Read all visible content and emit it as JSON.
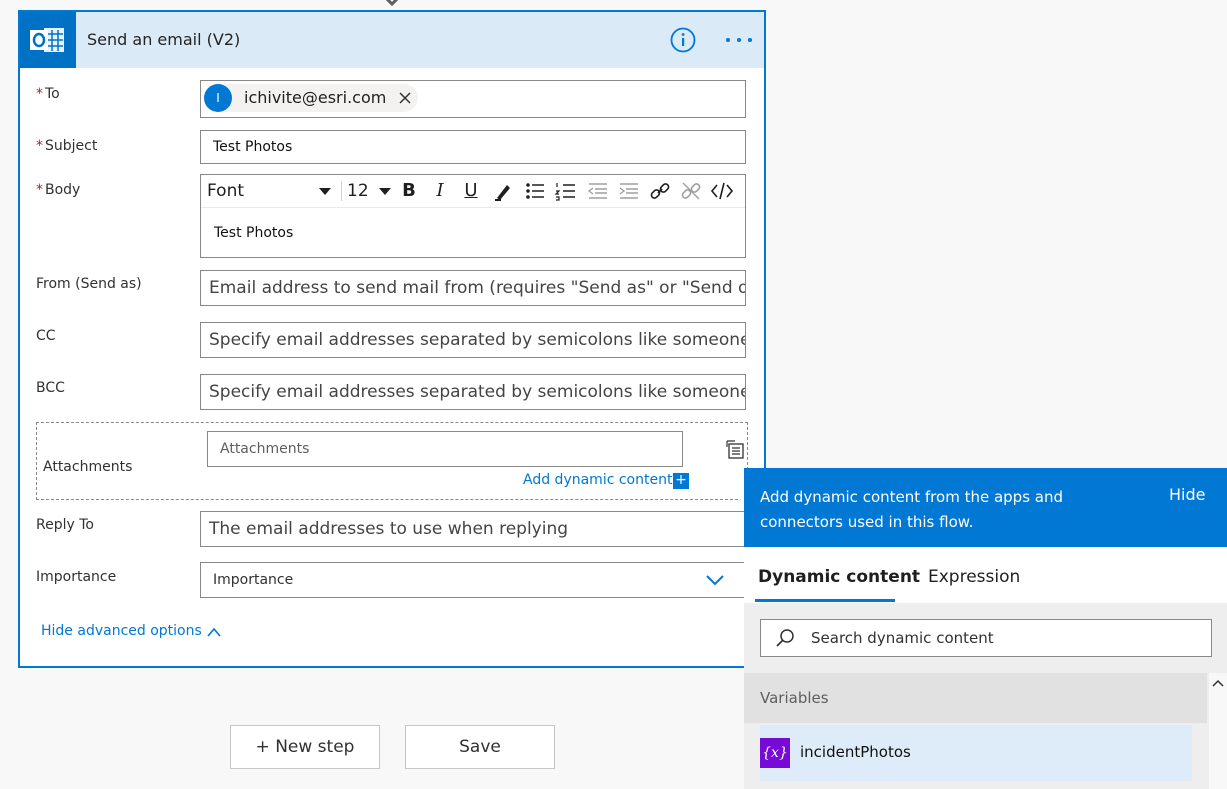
{
  "card": {
    "title": "Send an email (V2)",
    "icons": {
      "connector": "outlook-icon",
      "info": "info-icon",
      "menu": "more-icon"
    }
  },
  "fields": {
    "to": {
      "label": "To",
      "required_mark": "*",
      "token_initial": "I",
      "token_email": "ichivite@esri.com"
    },
    "subject": {
      "label": "Subject",
      "required_mark": "*",
      "value": "Test Photos"
    },
    "body": {
      "label": "Body",
      "required_mark": "*",
      "font_label": "Font",
      "size_label": "12",
      "value": "Test Photos",
      "toolbar": {
        "bold": "B",
        "italic": "I",
        "underline": "U"
      }
    },
    "from": {
      "label": "From (Send as)",
      "placeholder": "Email address to send mail from (requires \"Send as\" or \"Send on behalf of\" permission)"
    },
    "cc": {
      "label": "CC",
      "placeholder": "Specify email addresses separated by semicolons like someone@contoso.com"
    },
    "bcc": {
      "label": "BCC",
      "placeholder": "Specify email addresses separated by semicolons like someone@contoso.com"
    },
    "attachments": {
      "label": "Attachments",
      "placeholder": "Attachments",
      "add_dynamic": "Add dynamic content",
      "add_icon": "+"
    },
    "reply_to": {
      "label": "Reply To",
      "placeholder": "The email addresses to use when replying"
    },
    "importance": {
      "label": "Importance",
      "value": "Importance"
    }
  },
  "hide_advanced": "Hide advanced options",
  "buttons": {
    "new_step": "+ New step",
    "save": "Save"
  },
  "dynamic_panel": {
    "header": "Add dynamic content from the apps and connectors used in this flow.",
    "hide": "Hide",
    "tabs": [
      {
        "label": "Dynamic content",
        "active": true
      },
      {
        "label": "Expression",
        "active": false
      }
    ],
    "search_placeholder": "Search dynamic content",
    "group": "Variables",
    "items": [
      {
        "icon": "{x}",
        "label": "incidentPhotos"
      }
    ]
  },
  "colors": {
    "accent": "#0078d4",
    "header_bg": "#daeaf7",
    "outlook": "#0072c6",
    "variable_icon": "#770bd6"
  }
}
